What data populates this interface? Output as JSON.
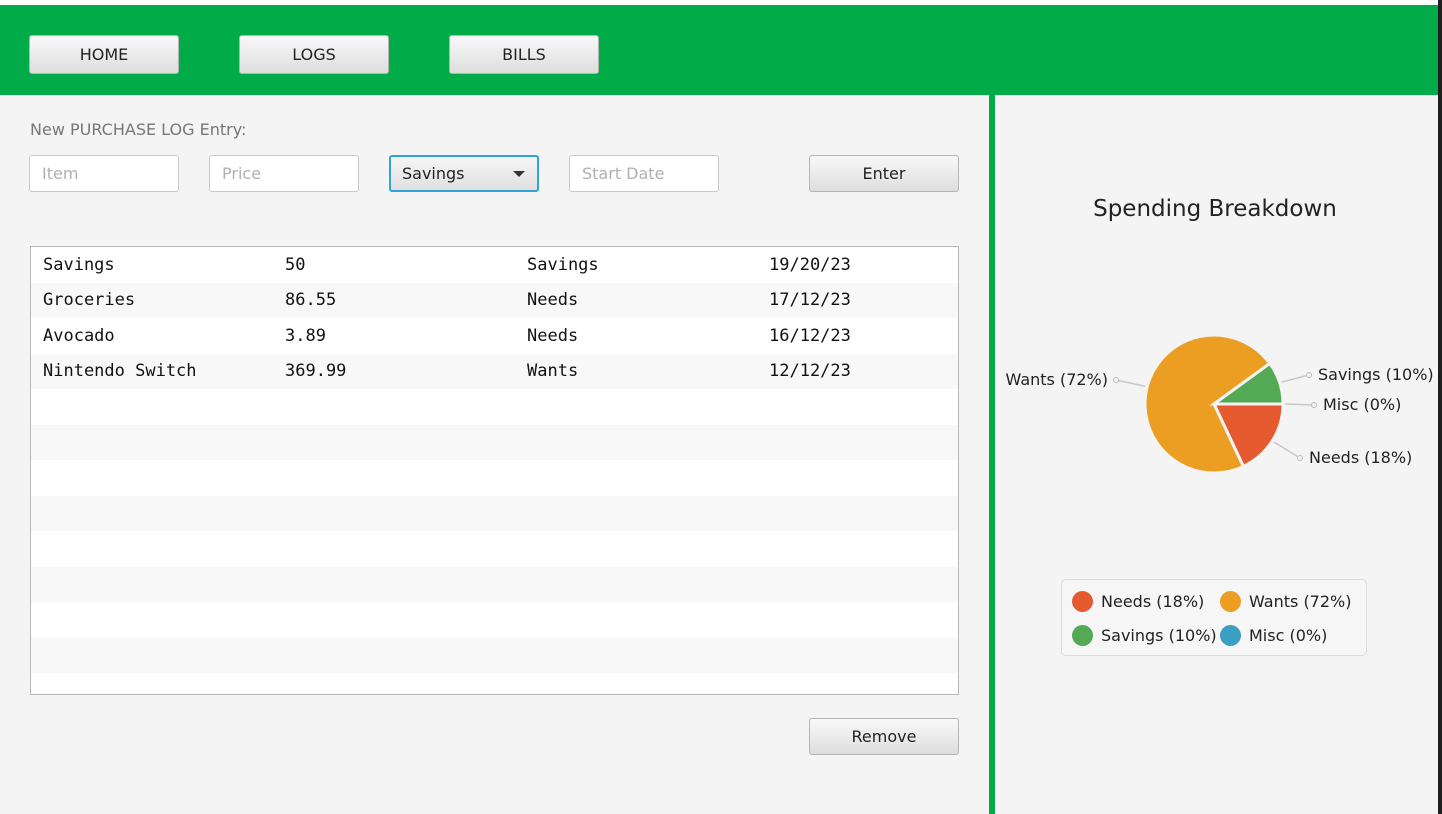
{
  "nav": {
    "home": "HOME",
    "logs": "LOGS",
    "bills": "BILLS"
  },
  "form": {
    "title": "New PURCHASE LOG Entry:",
    "item_placeholder": "Item",
    "price_placeholder": "Price",
    "category_selected": "Savings",
    "date_placeholder": "Start Date",
    "enter_label": "Enter"
  },
  "table": {
    "rows": [
      [
        "Savings",
        "50",
        "Savings",
        "19/20/23"
      ],
      [
        "Groceries",
        "86.55",
        "Needs",
        "17/12/23"
      ],
      [
        "Avocado",
        "3.89",
        "Needs",
        "16/12/23"
      ],
      [
        "Nintendo Switch",
        "369.99",
        "Wants",
        "12/12/23"
      ]
    ]
  },
  "remove_label": "Remove",
  "colors": {
    "accent": "#00ab48",
    "focus": "#2fa4d8"
  },
  "chart_data": {
    "type": "pie",
    "title": "Spending Breakdown",
    "slices": [
      {
        "name": "Needs",
        "label": "Needs (18%)",
        "value": 18,
        "color": "#e55a2f"
      },
      {
        "name": "Wants",
        "label": "Wants (72%)",
        "value": 72,
        "color": "#eb9e22"
      },
      {
        "name": "Savings",
        "label": "Savings (10%)",
        "value": 10,
        "color": "#54a955"
      },
      {
        "name": "Misc",
        "label": "Misc (0%)",
        "value": 0,
        "color": "#3a9fc0"
      }
    ],
    "legend": "bottom",
    "start_angle": 0,
    "direction": "clockwise"
  }
}
